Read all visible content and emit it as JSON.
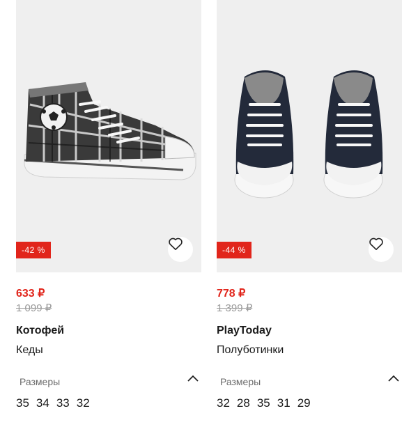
{
  "products": [
    {
      "discount": "-42 %",
      "price_new": "633 ₽",
      "price_old": "1 099 ₽",
      "brand": "Котофей",
      "type": "Кеды",
      "sizes_label": "Размеры",
      "sizes": [
        "35",
        "34",
        "33",
        "32"
      ],
      "image": "plaid-high-top-sneaker-with-soccer-ball"
    },
    {
      "discount": "-44 %",
      "price_new": "778 ₽",
      "price_old": "1 399 ₽",
      "brand": "PlayToday",
      "type": "Полуботинки",
      "sizes_label": "Размеры",
      "sizes": [
        "32",
        "28",
        "35",
        "31",
        "29"
      ],
      "image": "navy-low-top-sneakers-pair"
    }
  ],
  "icons": {
    "favorite": "heart-outline-icon",
    "collapse": "chevron-up-icon"
  },
  "colors": {
    "sale_red": "#e1251b",
    "old_price_gray": "#9a9a9a",
    "image_bg": "#efefef"
  }
}
